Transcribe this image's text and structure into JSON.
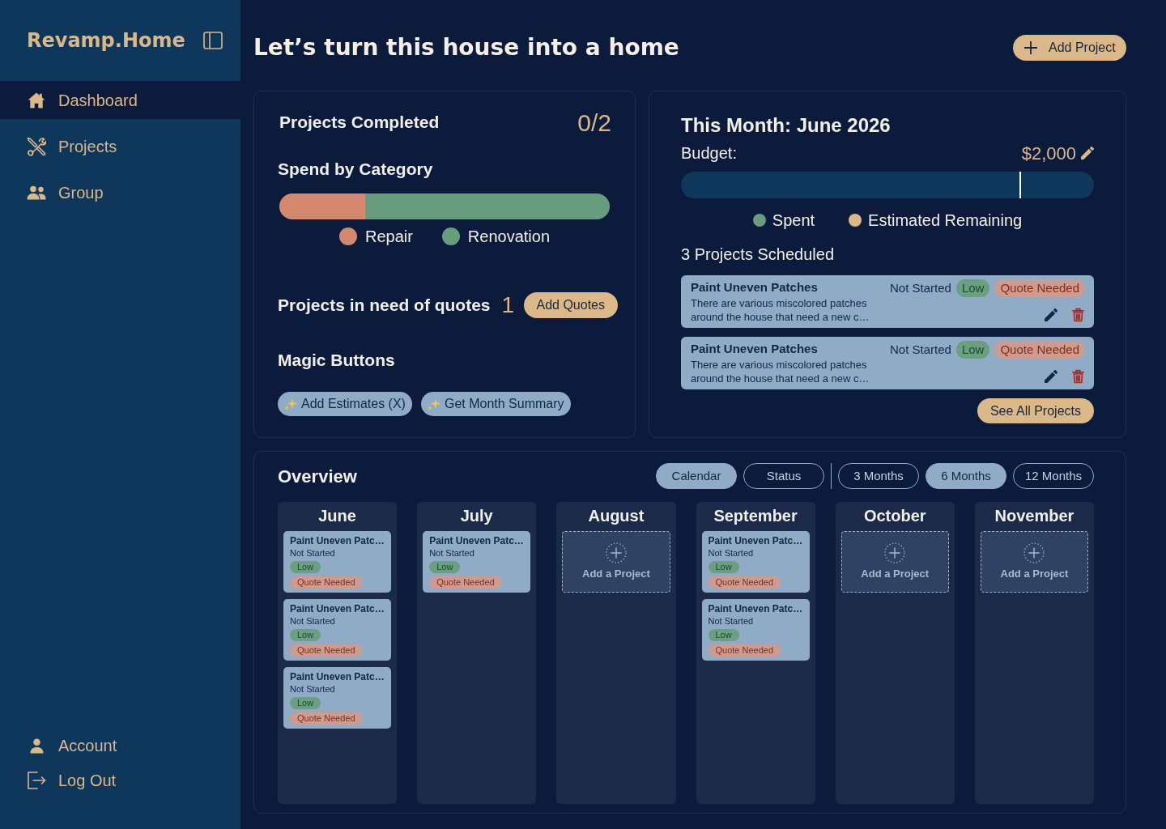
{
  "sidebar": {
    "logo": "Revamp.Home",
    "nav": [
      {
        "label": "Dashboard",
        "selected": true
      },
      {
        "label": "Projects",
        "selected": false
      },
      {
        "label": "Group",
        "selected": false
      }
    ],
    "footer": [
      "Account",
      "Log Out"
    ]
  },
  "header": {
    "title": "Let’s turn this house into a home",
    "button": "Add Project"
  },
  "summary": {
    "completed": {
      "label": "Projects Completed",
      "value": "0/2"
    },
    "spend": {
      "title": "Spend by Category",
      "segments": [
        {
          "name": "Repair",
          "color": "#d4896f",
          "level": 0.26
        },
        {
          "name": "Renovation",
          "color": "#679c7e",
          "level": 0.74
        }
      ]
    },
    "quotes": {
      "label": "Projects in need of quotes",
      "count": "1",
      "button": "Add Quotes"
    },
    "magic": {
      "title": "Magic Buttons",
      "buttons": [
        "Add Estimates (X)",
        "Get Month Summary"
      ]
    }
  },
  "this_month": {
    "title": "This Month: June 2026",
    "budget_label": "Budget:",
    "budget_value": "$2,000",
    "bar": {
      "marker": {
        "level": 0.82
      }
    },
    "legend": [
      {
        "name": "Spent",
        "color": "#679c7e"
      },
      {
        "name": "Estimated Remaining",
        "color": "#dab887"
      }
    ],
    "scheduled": "3 Projects Scheduled",
    "projects": [
      {
        "title": "Paint Uneven Patches",
        "description": "There are various miscolored patches around the house that need a new c…",
        "status": "Not Started",
        "tags": [
          {
            "label": "Low",
            "kind": "priority"
          },
          {
            "label": "Quote Needed",
            "kind": "quote"
          }
        ]
      },
      {
        "title": "Paint Uneven Patches",
        "description": "There are various miscolored patches around the house that need a new c…",
        "status": "Not Started",
        "tags": [
          {
            "label": "Low",
            "kind": "priority"
          },
          {
            "label": "Quote Needed",
            "kind": "quote"
          }
        ]
      }
    ],
    "button": "See All Projects"
  },
  "overview": {
    "title": "Overview",
    "views": [
      {
        "label": "Calendar",
        "selected": true
      },
      {
        "label": "Status",
        "selected": false
      }
    ],
    "ranges": [
      {
        "label": "3 Months",
        "selected": false
      },
      {
        "label": "6 Months",
        "selected": true
      },
      {
        "label": "12 Months",
        "selected": false
      }
    ],
    "columns": [
      {
        "month": "June",
        "cards": [
          {
            "title": "Paint Uneven Patc…",
            "status": "Not Started",
            "tags": [
              {
                "label": "Low",
                "kind": "priority"
              },
              {
                "label": "Quote Needed",
                "kind": "quote"
              }
            ]
          },
          {
            "title": "Paint Uneven Patc…",
            "status": "Not Started",
            "tags": [
              {
                "label": "Low",
                "kind": "priority"
              },
              {
                "label": "Quote Needed",
                "kind": "quote"
              }
            ]
          },
          {
            "title": "Paint Uneven Patc…",
            "status": "Not Started",
            "tags": [
              {
                "label": "Low",
                "kind": "priority"
              },
              {
                "label": "Quote Needed",
                "kind": "quote"
              }
            ]
          }
        ]
      },
      {
        "month": "July",
        "cards": [
          {
            "title": "Paint Uneven Patc…",
            "status": "Not Started",
            "tags": [
              {
                "label": "Low",
                "kind": "priority"
              },
              {
                "label": "Quote Needed",
                "kind": "quote"
              }
            ]
          }
        ]
      },
      {
        "month": "August",
        "add_label": "Add a Project"
      },
      {
        "month": "September",
        "cards": [
          {
            "title": "Paint Uneven Patc…",
            "status": "Not Started",
            "tags": [
              {
                "label": "Low",
                "kind": "priority"
              },
              {
                "label": "Quote Needed",
                "kind": "quote"
              }
            ]
          },
          {
            "title": "Paint Uneven Patc…",
            "status": "Not Started",
            "tags": [
              {
                "label": "Low",
                "kind": "priority"
              },
              {
                "label": "Quote Needed",
                "kind": "quote"
              }
            ]
          }
        ]
      },
      {
        "month": "October",
        "add_label": "Add a Project"
      },
      {
        "month": "November",
        "add_label": "Add a Project"
      }
    ]
  }
}
